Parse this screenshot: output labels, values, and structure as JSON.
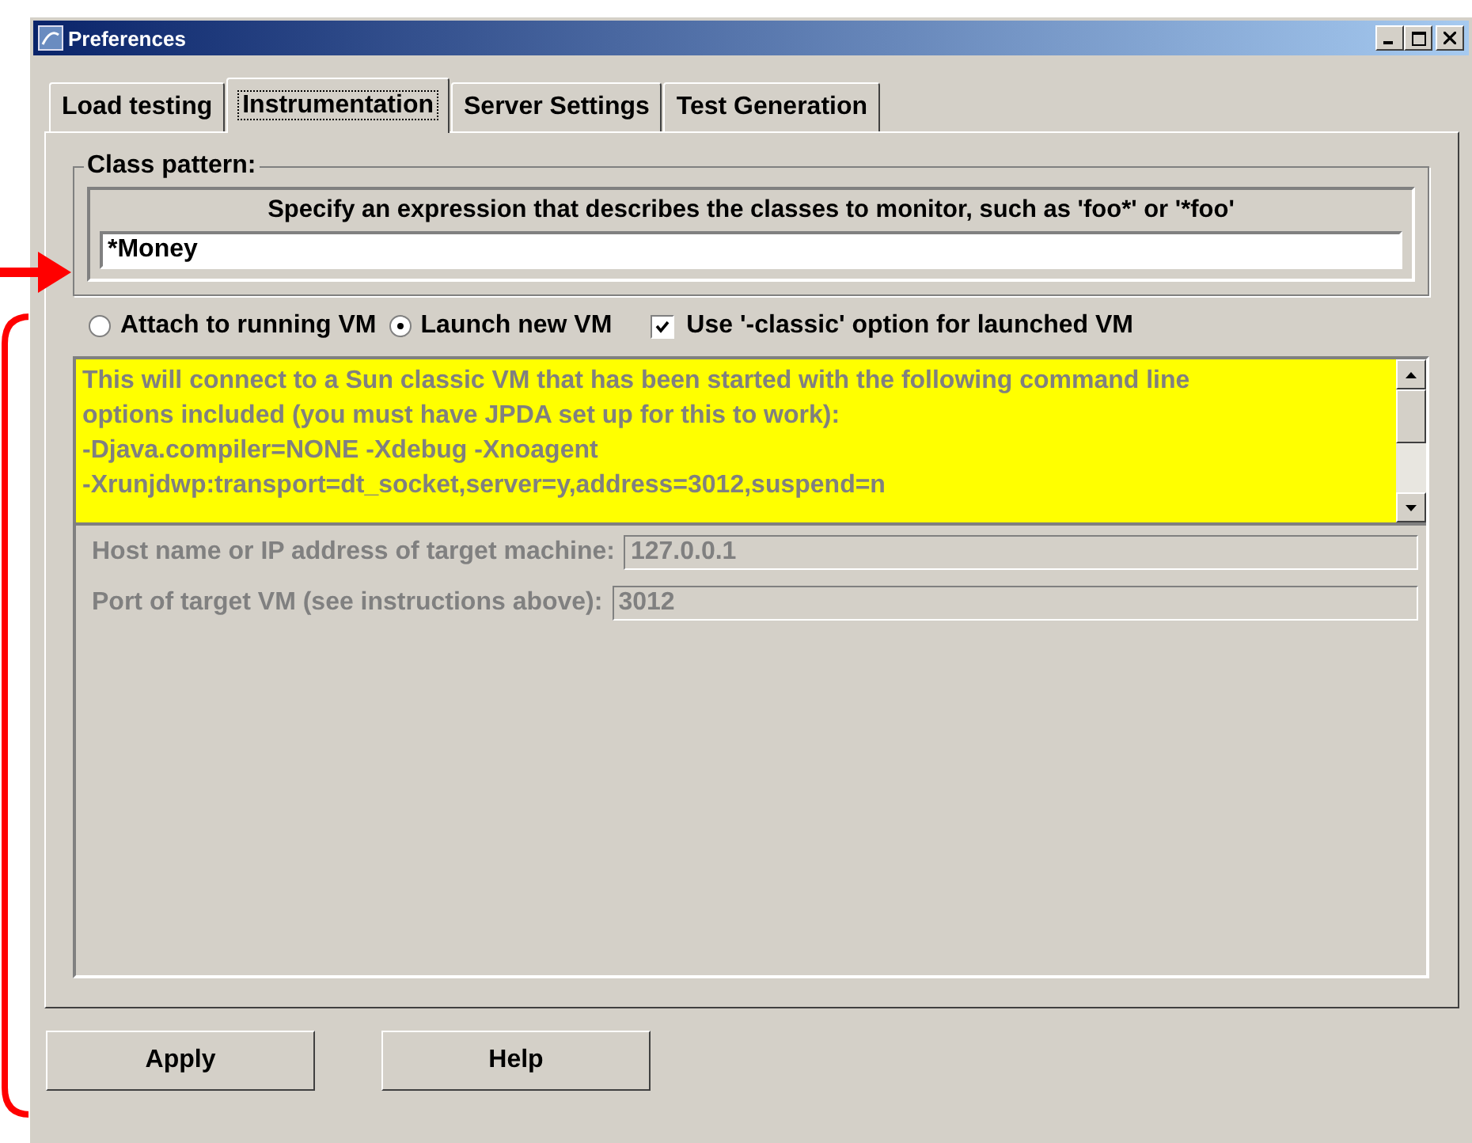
{
  "window": {
    "title": "Preferences"
  },
  "tabs": [
    {
      "label": "Load testing",
      "selected": false
    },
    {
      "label": "Instrumentation",
      "selected": true
    },
    {
      "label": "Server Settings",
      "selected": false
    },
    {
      "label": "Test Generation",
      "selected": false
    }
  ],
  "class_pattern": {
    "legend": "Class pattern:",
    "hint": "Specify an expression that describes the classes to monitor, such as 'foo*' or '*foo'",
    "value": "*Money"
  },
  "vm_options": [
    {
      "label": "Attach to running VM",
      "selected": false
    },
    {
      "label": "Launch new VM",
      "selected": true
    }
  ],
  "classic_option": {
    "label": "Use '-classic' option for launched VM",
    "checked": true
  },
  "info_text": [
    "This will connect to a Sun classic VM that has been started with the following command line",
    "options included (you must have JPDA set up for this to work):",
    "-Djava.compiler=NONE -Xdebug -Xnoagent",
    "-Xrunjdwp:transport=dt_socket,server=y,address=3012,suspend=n"
  ],
  "target_fields": [
    {
      "label": "Host name or IP address of target machine:",
      "value": "127.0.0.1",
      "disabled": true
    },
    {
      "label": "Port of target VM (see instructions above):",
      "value": "3012",
      "disabled": true
    }
  ],
  "buttons": [
    "Apply",
    "Help"
  ]
}
